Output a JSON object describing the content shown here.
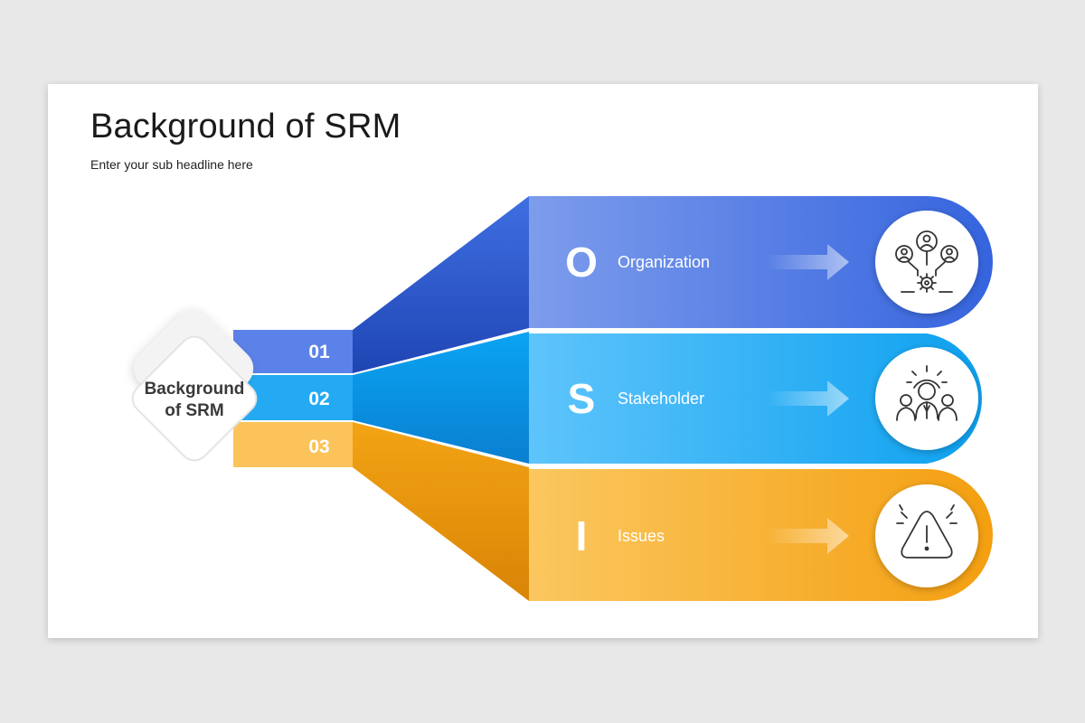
{
  "slide": {
    "title": "Background of SRM",
    "subtitle": "Enter your sub headline here"
  },
  "hub": {
    "line1": "Background",
    "line2": "of SRM"
  },
  "items": [
    {
      "number": "01",
      "letter": "O",
      "label": "Organization",
      "icon": "organization-network-icon",
      "color": "#3e6ee4"
    },
    {
      "number": "02",
      "letter": "S",
      "label": "Stakeholder",
      "icon": "stakeholder-team-gear-icon",
      "color": "#1aa3f0"
    },
    {
      "number": "03",
      "letter": "I",
      "label": "Issues",
      "icon": "warning-triangle-icon",
      "color": "#f5a312"
    }
  ]
}
